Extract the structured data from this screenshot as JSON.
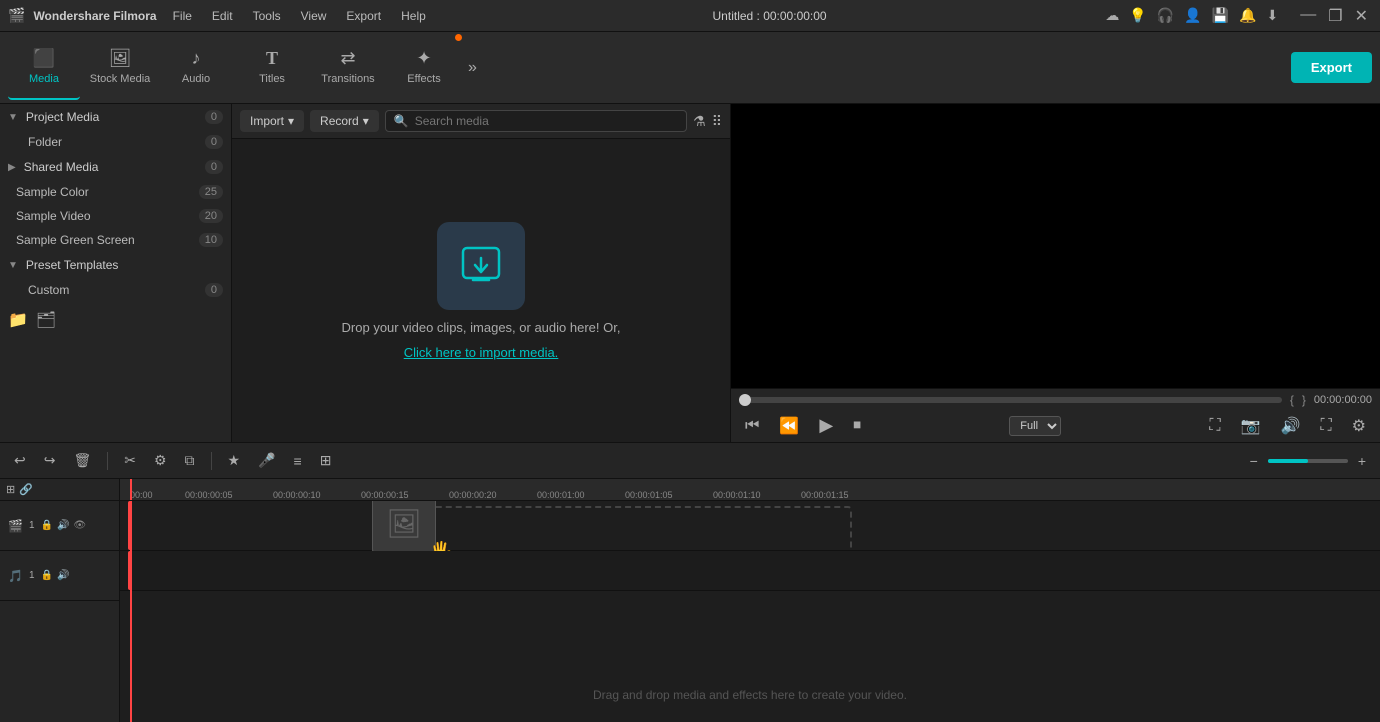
{
  "app": {
    "name": "Wondershare Filmora",
    "logo": "🎬",
    "title": "Untitled : 00:00:00:00"
  },
  "titlebar": {
    "menu_items": [
      "File",
      "Edit",
      "Tools",
      "View",
      "Export",
      "Help"
    ],
    "window_controls": [
      "—",
      "❐",
      "✕"
    ]
  },
  "toolbar": {
    "items": [
      {
        "id": "media",
        "label": "Media",
        "icon": "⬛",
        "active": true
      },
      {
        "id": "stock_media",
        "label": "Stock Media",
        "icon": "🖼"
      },
      {
        "id": "audio",
        "label": "Audio",
        "icon": "♪"
      },
      {
        "id": "titles",
        "label": "Titles",
        "icon": "T"
      },
      {
        "id": "transitions",
        "label": "Transitions",
        "icon": "⇄"
      },
      {
        "id": "effects",
        "label": "Effects",
        "icon": "✦",
        "dot": true
      }
    ],
    "export_label": "Export"
  },
  "sidebar": {
    "sections": [
      {
        "id": "project_media",
        "label": "Project Media",
        "count": 0,
        "expanded": true,
        "children": [
          {
            "id": "folder",
            "label": "Folder",
            "count": 0
          }
        ]
      },
      {
        "id": "shared_media",
        "label": "Shared Media",
        "count": 0,
        "expanded": false,
        "children": []
      },
      {
        "id": "sample_color",
        "label": "Sample Color",
        "count": 25,
        "expanded": false,
        "children": []
      },
      {
        "id": "sample_video",
        "label": "Sample Video",
        "count": 20,
        "expanded": false,
        "children": []
      },
      {
        "id": "sample_green_screen",
        "label": "Sample Green Screen",
        "count": 10,
        "expanded": false,
        "children": []
      },
      {
        "id": "preset_templates",
        "label": "Preset Templates",
        "count": null,
        "expanded": true,
        "children": [
          {
            "id": "custom",
            "label": "Custom",
            "count": 0
          }
        ]
      }
    ]
  },
  "media_panel": {
    "import_label": "Import",
    "record_label": "Record",
    "search_placeholder": "Search media",
    "drop_text": "Drop your video clips, images, or audio here! Or,",
    "drop_link": "Click here to import media."
  },
  "preview": {
    "time": "00:00:00:00",
    "quality": "Full",
    "markers": [
      "{",
      "}"
    ]
  },
  "timeline": {
    "toolbar_items": [
      "↩",
      "↪",
      "🗑",
      "✂",
      "⚙",
      "⧉"
    ],
    "drop_hint": "Drag and drop media and effects here to create your video.",
    "rulers": [
      "00:00",
      "00:00:00:05",
      "00:00:00:10",
      "00:00:00:15",
      "00:00:00:20",
      "00:00:01:00",
      "00:00:01:05",
      "00:00:01:10",
      "00:00:01:15"
    ]
  }
}
